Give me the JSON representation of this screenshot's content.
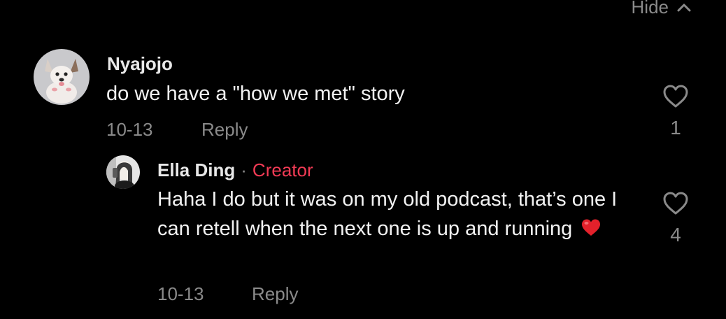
{
  "thread": {
    "hide_label": "Hide"
  },
  "comment": {
    "username": "Nyajojo",
    "text": "do we have a \"how we met\" story",
    "date": "10-13",
    "reply_label": "Reply",
    "like_count": "1"
  },
  "reply": {
    "username": "Ella Ding",
    "separator": "·",
    "badge": "Creator",
    "text": "Haha I do but it was on my old podcast, that’s one I can retell when the next one is up and running",
    "emoji": "red-heart-emoji",
    "date": "10-13",
    "reply_label": "Reply",
    "like_count": "4"
  },
  "colors": {
    "background": "#000000",
    "muted": "#8a8a8a",
    "creator_badge": "#f23b55",
    "heart_emoji": "#e3212b"
  },
  "icons": {
    "hide_toggle": "chevron-up-icon",
    "like": "heart-outline-icon"
  }
}
